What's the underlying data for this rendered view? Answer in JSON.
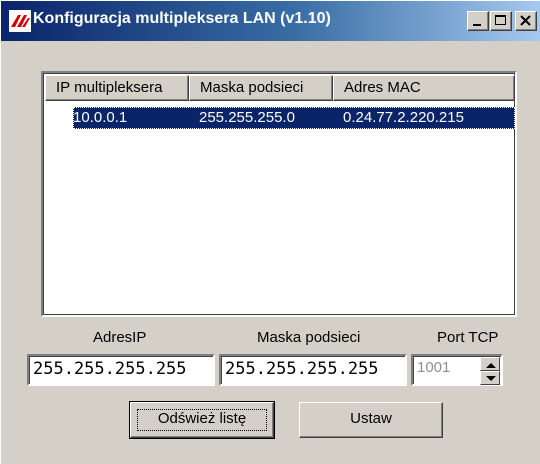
{
  "window": {
    "title": "Konfiguracja multipleksera LAN (v1.10)",
    "icon": "red-logo-icon",
    "controls": {
      "minimize": "minimize-icon",
      "maximize": "maximize-icon",
      "close": "close-icon"
    }
  },
  "list": {
    "columns": [
      "IP multipleksera",
      "Maska podsieci",
      "Adres MAC"
    ],
    "rows": [
      {
        "ip": "10.0.0.1",
        "mask": "255.255.255.0",
        "mac": "0.24.77.2.220.215",
        "selected": true
      }
    ]
  },
  "fields": {
    "ip_label": "AdresIP",
    "ip_value": "255.255.255.255",
    "mask_label": "Maska podsieci",
    "mask_value": "255.255.255.255",
    "port_label": "Port TCP",
    "port_value": "1001"
  },
  "buttons": {
    "refresh": "Odśwież listę",
    "set": "Ustaw"
  },
  "colors": {
    "selection": "#0a246a",
    "titlebar_start": "#0a246a",
    "titlebar_end": "#a6caf0",
    "face": "#d4d0c8"
  }
}
